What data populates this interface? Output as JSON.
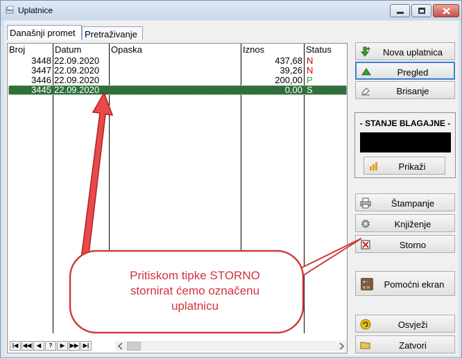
{
  "window": {
    "title": "Uplatnice"
  },
  "tabs": [
    {
      "label": "Današnji promet"
    },
    {
      "label": "Pretraživanje"
    }
  ],
  "grid": {
    "columns": [
      "Broj",
      "Datum",
      "Opaska",
      "Iznos",
      "Status"
    ],
    "rows": [
      {
        "broj": "3448",
        "datum": "22.09.2020",
        "opaska": "",
        "iznos": "437,68",
        "status": "N",
        "status_color": "#cc0000"
      },
      {
        "broj": "3447",
        "datum": "22.09.2020",
        "opaska": "",
        "iznos": "39,26",
        "status": "N",
        "status_color": "#cc0000"
      },
      {
        "broj": "3446",
        "datum": "22.09.2020",
        "opaska": "",
        "iznos": "200,00",
        "status": "P",
        "status_color": "#3a9a2a"
      },
      {
        "broj": "3445",
        "datum": "22.09.2020",
        "opaska": "",
        "iznos": "0,00",
        "status": "S",
        "status_color": "#ffffff",
        "selected": true
      }
    ],
    "nav": [
      "|◀",
      "◀◀",
      "◀",
      "?",
      "▶",
      "▶▶",
      "▶|"
    ]
  },
  "buttons": {
    "nova": "Nova uplatnica",
    "pregled": "Pregled",
    "brisanje": "Brisanje",
    "prikazi": "Prikaži",
    "stampanje": "Štampanje",
    "knjizenje": "Knjiženje",
    "storno": "Storno",
    "pomocni": "Pomoćni ekran",
    "osvjezi": "Osvježi",
    "zatvori": "Zatvori"
  },
  "stanje": {
    "title": "- STANJE BLAGAJNE -"
  },
  "callout": {
    "line1": "Pritiskom tipke STORNO",
    "line2": "stornirat ćemo označenu",
    "line3": "uplatnicu"
  },
  "colors": {
    "selection": "#2f6f3c",
    "annotation": "#e23c3c",
    "focus_border": "#3c7fd2"
  }
}
